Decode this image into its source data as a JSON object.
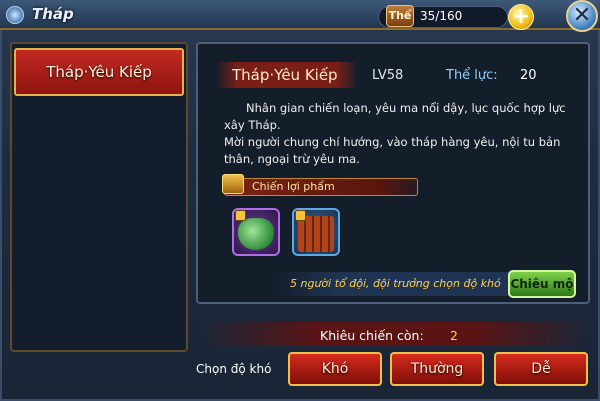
{
  "window": {
    "title": "Tháp",
    "close_icon": "close-x-icon"
  },
  "stamina": {
    "label": "Thể",
    "value": "35/160",
    "add_label": "+"
  },
  "left_list": {
    "items": [
      {
        "label": "Tháp·Yêu Kiếp"
      }
    ]
  },
  "detail": {
    "name": "Tháp·Yêu Kiếp",
    "level": "LV58",
    "stamina_label": "Thể lực:",
    "stamina_value": "20",
    "description_1": "Nhân gian chiến loạn, yêu ma nổi dậy, lục quốc hợp lực xây Tháp.",
    "description_2": "Mời người chung chí hướng, vào tháp hàng yêu, nội tu bản thân, ngoại trừ yêu ma.",
    "loot_label": "Chiến lợi phẩm",
    "loot_items": [
      {
        "icon": "green-bag-icon"
      },
      {
        "icon": "bundle-sticks-icon"
      }
    ],
    "party_hint": "5 người tổ đội, đội trưởng chọn độ khó",
    "recruit_label": "Chiêu mộ"
  },
  "challenge": {
    "label": "Khiêu chiến còn:",
    "value": "2"
  },
  "difficulty": {
    "label": "Chọn độ khó",
    "options": [
      {
        "label": "Khó"
      },
      {
        "label": "Thường"
      },
      {
        "label": "Dễ"
      }
    ]
  },
  "colors": {
    "accent_red": "#c22a22",
    "gold_border": "#e6b24a",
    "panel_bg": "#141d2a"
  }
}
